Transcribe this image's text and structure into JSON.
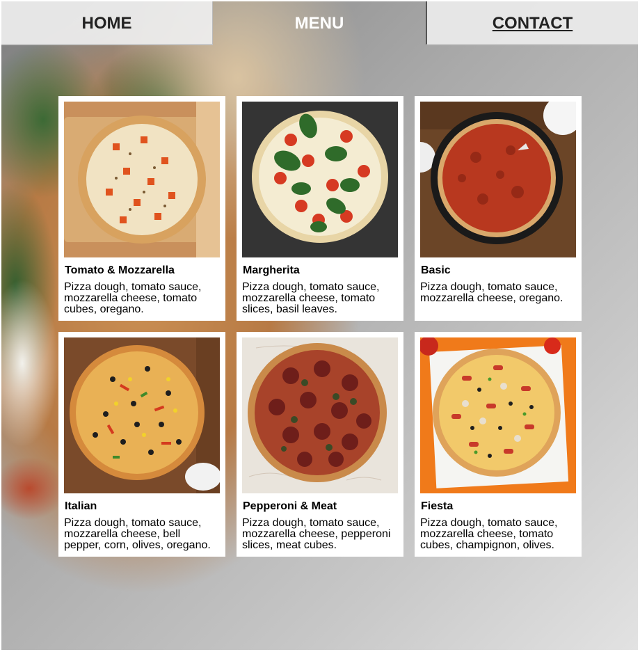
{
  "nav": {
    "home": "HOME",
    "menu": "MENU",
    "contact": "CONTACT"
  },
  "items": [
    {
      "title": "Tomato & Mozzarella",
      "desc": "Pizza dough, tomato sauce, mozzarella cheese, tomato cubes, oregano."
    },
    {
      "title": "Margherita",
      "desc": "Pizza dough, tomato sauce, mozzarella cheese, tomato slices, basil leaves."
    },
    {
      "title": "Basic",
      "desc": "Pizza dough, tomato sauce, mozzarella cheese, oregano."
    },
    {
      "title": "Italian",
      "desc": "Pizza dough, tomato sauce, mozzarella cheese, bell pepper, corn, olives, oregano."
    },
    {
      "title": "Pepperoni & Meat",
      "desc": "Pizza dough, tomato sauce, mozzarella cheese, pepperoni slices, meat cubes."
    },
    {
      "title": "Fiesta",
      "desc": "Pizza dough, tomato sauce, mozzarella cheese, tomato cubes, champignon, olives."
    }
  ]
}
